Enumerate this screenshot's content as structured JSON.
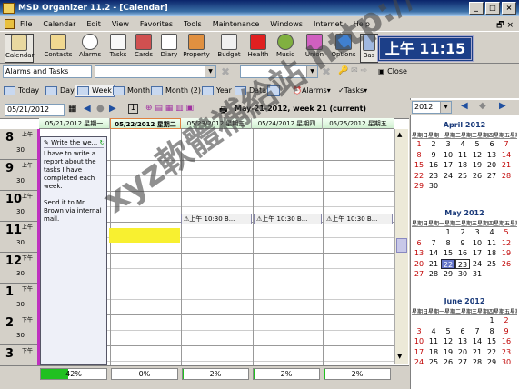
{
  "window": {
    "title": "MSD Organizer 11.2 - [Calendar]"
  },
  "menu": [
    "File",
    "Calendar",
    "Edit",
    "View",
    "Favorites",
    "Tools",
    "Maintenance",
    "Windows",
    "Internet",
    "Help"
  ],
  "toolbar": [
    "Calendar",
    "Contacts",
    "Alarms",
    "Tasks",
    "Cards",
    "Diary",
    "Property",
    "Budget",
    "Health",
    "Music",
    "Union",
    "Options",
    "Bas"
  ],
  "clock": "上午 11:15",
  "filter": {
    "category": "Alarms and Tasks",
    "close_label": "Close"
  },
  "views": {
    "today": "Today",
    "day": "Day",
    "week": "Week",
    "month": "Month",
    "month2": "Month (2)",
    "year": "Year",
    "data": "Data",
    "alarms": "Alarms",
    "tasks": "Tasks"
  },
  "nav": {
    "date": "05/21/2012",
    "week_label": "May-21-2012, week 21 (current)"
  },
  "columns": [
    "05/21/2012 星期一",
    "05/22/2012 星期二",
    "05/23/2012 星期三",
    "05/24/2012 星期四",
    "05/25/2012 星期五"
  ],
  "hours": [
    {
      "h": "8",
      "ap": "上午",
      "half": "30"
    },
    {
      "h": "9",
      "ap": "上午",
      "half": "30"
    },
    {
      "h": "10",
      "ap": "上午",
      "half": "30"
    },
    {
      "h": "11",
      "ap": "上午",
      "half": "30"
    },
    {
      "h": "12",
      "ap": "下午",
      "half": "30"
    },
    {
      "h": "1",
      "ap": "下午",
      "half": "30"
    },
    {
      "h": "2",
      "ap": "下午",
      "half": "30"
    },
    {
      "h": "3",
      "ap": "下午",
      "half": ""
    }
  ],
  "appointment": {
    "title": "Write the we...",
    "body": "I have to write a report about the tasks I have completed each week.",
    "body2": "Send it to Mr. Brown via internal mail."
  },
  "events": [
    "上午 10:30 B...",
    "上午 10:30 B...",
    "上午 10:30 B..."
  ],
  "progress": [
    {
      "label": "42%",
      "value": 0.42
    },
    {
      "label": "0%",
      "value": 0
    },
    {
      "label": "2%",
      "value": 0.02
    },
    {
      "label": "2%",
      "value": 0.02
    },
    {
      "label": "2%",
      "value": 0.02
    }
  ],
  "right": {
    "year": "2012",
    "weekdays": "星期日星期一星期二星期三星期四星期五星期六",
    "april": {
      "title": "April 2012",
      "days": [
        "1",
        "2",
        "3",
        "4",
        "5",
        "6",
        "7",
        "8",
        "9",
        "10",
        "11",
        "12",
        "13",
        "14",
        "15",
        "16",
        "17",
        "18",
        "19",
        "20",
        "21",
        "22",
        "23",
        "24",
        "25",
        "26",
        "27",
        "28",
        "29",
        "30"
      ]
    },
    "may": {
      "title": "May 2012",
      "days": [
        "",
        "",
        "1",
        "2",
        "3",
        "4",
        "5",
        "6",
        "7",
        "8",
        "9",
        "10",
        "11",
        "12",
        "13",
        "14",
        "15",
        "16",
        "17",
        "18",
        "19",
        "20",
        "21",
        "22",
        "23",
        "24",
        "25",
        "26",
        "27",
        "28",
        "29",
        "30",
        "31"
      ]
    },
    "june": {
      "title": "June 2012",
      "days": [
        "",
        "",
        "",
        "",
        "",
        "1",
        "2",
        "3",
        "4",
        "5",
        "6",
        "7",
        "8",
        "9",
        "10",
        "11",
        "12",
        "13",
        "14",
        "15",
        "16",
        "17",
        "18",
        "19",
        "20",
        "21",
        "22",
        "23",
        "24",
        "25",
        "26",
        "27",
        "28",
        "29",
        "30"
      ]
    }
  },
  "watermark": "xyz軟體補給站 http://31.to"
}
